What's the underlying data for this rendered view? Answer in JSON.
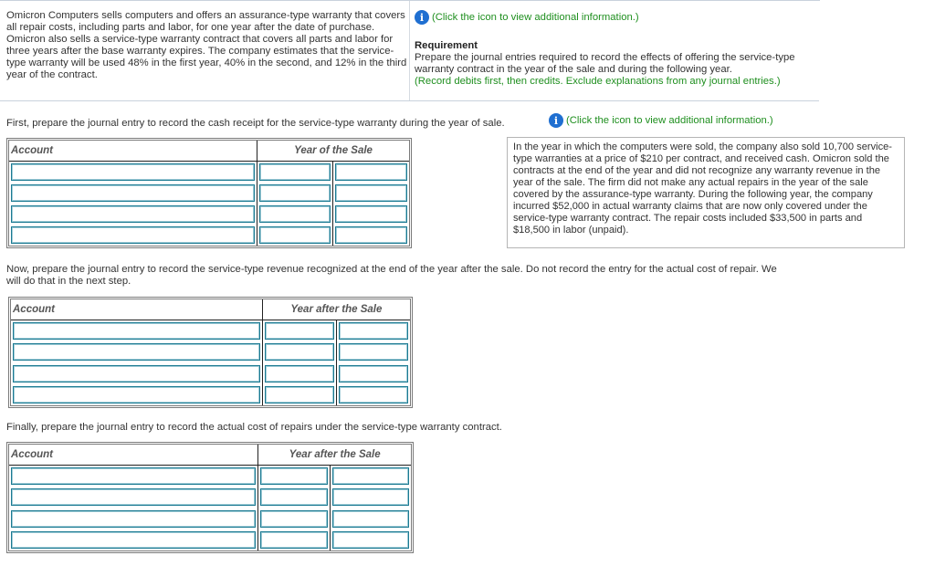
{
  "problem": {
    "text": "Omicron Computers sells computers and offers an assurance-type warranty that covers all repair costs, including parts and labor, for one year after the date of purchase. Omicron also sells a service-type warranty contract that covers all parts and labor for three years after the base warranty expires. The company estimates that the service-type warranty will be used 48% in the first year, 40% in the second, and 12% in the third year of the contract."
  },
  "right_panel": {
    "info_link": "(Click the icon to view additional information.)",
    "requirement_title": "Requirement",
    "requirement_body": "Prepare the journal entries required to record the effects of offering the service-type warranty contract in the year of the sale and during the following year.",
    "requirement_note": "(Record debits first, then credits. Exclude explanations from any journal entries.)"
  },
  "step1": {
    "instruction": "First, prepare the journal entry to record the cash receipt for the service-type warranty during the year of sale.",
    "info_link": "(Click the icon to view additional information.)",
    "table": {
      "account_header": "Account",
      "period_header": "Year of the Sale",
      "rows": 4
    }
  },
  "additional_info": {
    "text": "In the year in which the computers were sold, the company also sold 10,700 service-type warranties at a price of $210 per contract, and received cash. Omicron sold the contracts at the end of the year and did not recognize any warranty revenue in the year of the sale. The firm did not make any actual repairs in the year of the sale covered by the assurance-type warranty. During the following year, the company incurred $52,000 in actual warranty claims that are now only covered under the service-type warranty contract. The repair costs included $33,500 in parts and $18,500 in labor (unpaid)."
  },
  "step2": {
    "instruction": "Now, prepare the journal entry to record the service-type revenue recognized at the end of the year after the sale. Do not record the entry for the actual cost of repair. We will do that in the next step.",
    "table": {
      "account_header": "Account",
      "period_header": "Year after the Sale",
      "rows": 4
    }
  },
  "step3": {
    "instruction": "Finally, prepare the journal entry to record the actual cost of repairs under the service-type warranty contract.",
    "table": {
      "account_header": "Account",
      "period_header": "Year after the Sale",
      "rows": 4
    }
  },
  "icons": {
    "info": "info-icon"
  },
  "colors": {
    "accent_green": "#1f8f1f",
    "info_blue": "#1f6fd1",
    "input_border": "#1b7a92"
  }
}
